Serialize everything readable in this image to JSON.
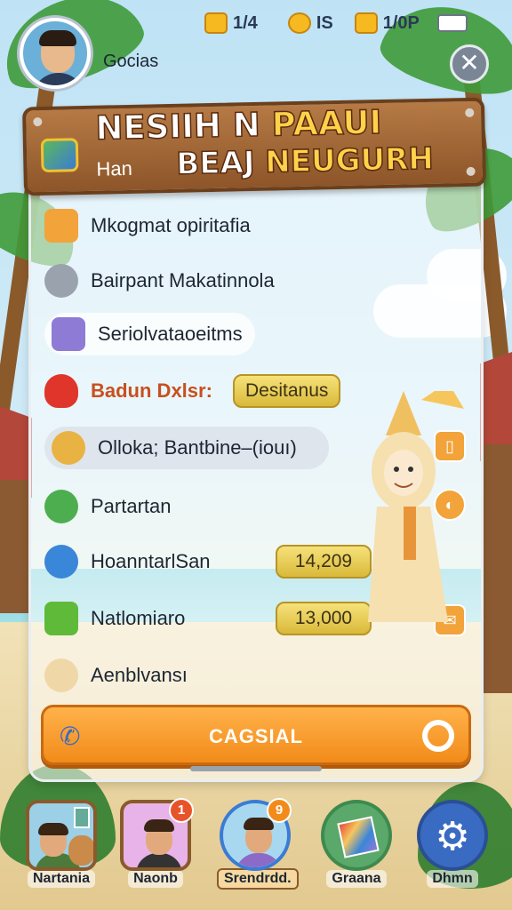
{
  "status": {
    "coins": "1/4",
    "gems": "IS",
    "energy": "1/0P"
  },
  "profile": {
    "name": "Gocias"
  },
  "banner": {
    "title_white": "NESIIH N",
    "title_gold": "PAAUI",
    "subtitle": "Han",
    "line2_white": "BEAJ",
    "line2_gold": "NEUGURH"
  },
  "menu": [
    {
      "label": "Mkogmat opiritafia",
      "icon": "package-icon",
      "color": "#f2a33a"
    },
    {
      "label": "Bairpant Makatinnola",
      "icon": "gear-icon",
      "color": "#9aa3ad"
    },
    {
      "label": "Seriolvataoeitms",
      "icon": "screen-icon",
      "color": "#8e7bd6"
    },
    {
      "label": "Badun Dxlsr:",
      "icon": "heart-icon",
      "color": "#e0352b",
      "tag": "Desitanus"
    },
    {
      "label": "Olloka; Bantbine–(iouı)",
      "icon": "cookie-icon",
      "color": "#e9b343"
    },
    {
      "label": "Partartan",
      "icon": "leaf-icon",
      "color": "#4cae4f"
    },
    {
      "label": "HoanntarlSan",
      "icon": "check-icon",
      "color": "#3a86d9",
      "value": "14,209"
    },
    {
      "label": "Natlomiaro",
      "icon": "box-check-icon",
      "color": "#5fba3a",
      "value": "13,000"
    },
    {
      "label": "Aenblvansı",
      "icon": "avatar-icon",
      "color": "#f0d7a8"
    }
  ],
  "cta": {
    "label": "CAGSIAL"
  },
  "bottom_nav": [
    {
      "label": "Nartania",
      "badge": ""
    },
    {
      "label": "Naonb",
      "badge": "1"
    },
    {
      "label": "Srendrdd.",
      "badge": "9"
    },
    {
      "label": "Graana",
      "badge": ""
    },
    {
      "label": "Dhmn",
      "badge": ""
    }
  ]
}
